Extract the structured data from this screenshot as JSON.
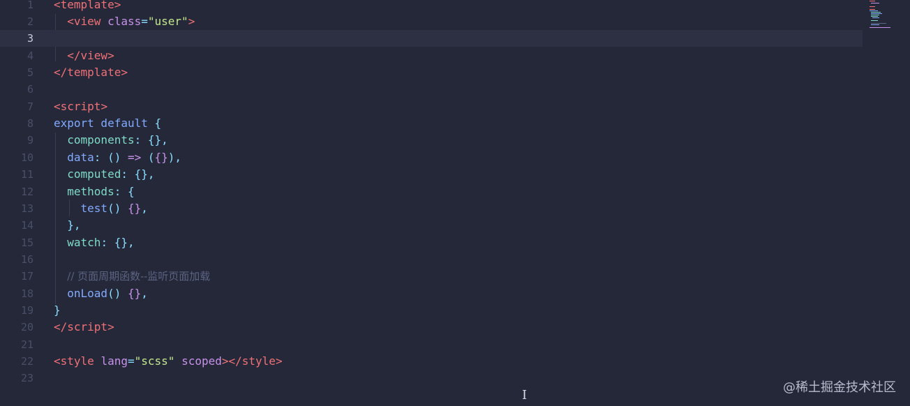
{
  "editor": {
    "current_line": 3,
    "lines": [
      {
        "num": "1"
      },
      {
        "num": "2"
      },
      {
        "num": "3"
      },
      {
        "num": "4"
      },
      {
        "num": "5"
      },
      {
        "num": "6"
      },
      {
        "num": "7"
      },
      {
        "num": "8"
      },
      {
        "num": "9"
      },
      {
        "num": "10"
      },
      {
        "num": "11"
      },
      {
        "num": "12"
      },
      {
        "num": "13"
      },
      {
        "num": "14"
      },
      {
        "num": "15"
      },
      {
        "num": "16"
      },
      {
        "num": "17"
      },
      {
        "num": "18"
      },
      {
        "num": "19"
      },
      {
        "num": "20"
      },
      {
        "num": "21"
      },
      {
        "num": "22"
      },
      {
        "num": "23"
      }
    ],
    "tokens": {
      "template": "template",
      "view": "view",
      "class_attr": "class",
      "user_str": "\"user\"",
      "script": "script",
      "export_default": "export default",
      "components": "components",
      "data": "data",
      "computed": "computed",
      "methods": "methods",
      "test": "test",
      "watch": "watch",
      "comment": "// 页面周期函数--监听页面加载",
      "onLoad": "onLoad",
      "style": "style",
      "lang_attr": "lang",
      "scss_str": "\"scss\"",
      "scoped_attr": "scoped"
    }
  },
  "watermark": "@稀土掘金技术社区",
  "cursor_glyph": "I",
  "colors": {
    "background": "#252838",
    "current_line": "#2c3042",
    "tag": "#f07178",
    "attribute": "#c792ea",
    "string": "#c3e88d",
    "keyword": "#82aaff",
    "property": "#7fdbca",
    "comment": "#5c6383"
  }
}
